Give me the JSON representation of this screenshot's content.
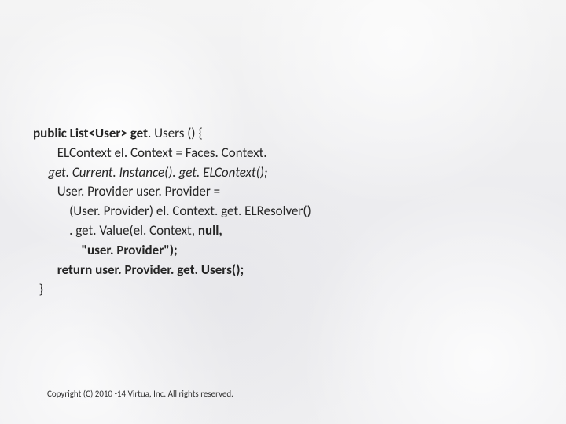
{
  "code": {
    "l1a": "public List<User> get",
    "l1b": ". Users () {",
    "l2a": "        ELContext el",
    "l2b": ". Context = Faces. Context.",
    "l3a": "     get",
    "l3b": ". Current. Instance(). get. ELContext();",
    "l4a": "        User. Provider user",
    "l4b": ". Provider =",
    "l5a": "            (User. Provider) el",
    "l5b": ". Context. get. ELResolver()",
    "l6a": "            . get",
    "l6b": ". Value(el. Context, ",
    "l6c": "null,",
    "l7a": "                \"user",
    "l7b": ". Provider\");",
    "l8a": "        return user",
    "l8b": ". Provider. get. Users();",
    "l9": "  }"
  },
  "footer": "Copyright (C) 2010 -14 Virtua, Inc. All rights reserved."
}
